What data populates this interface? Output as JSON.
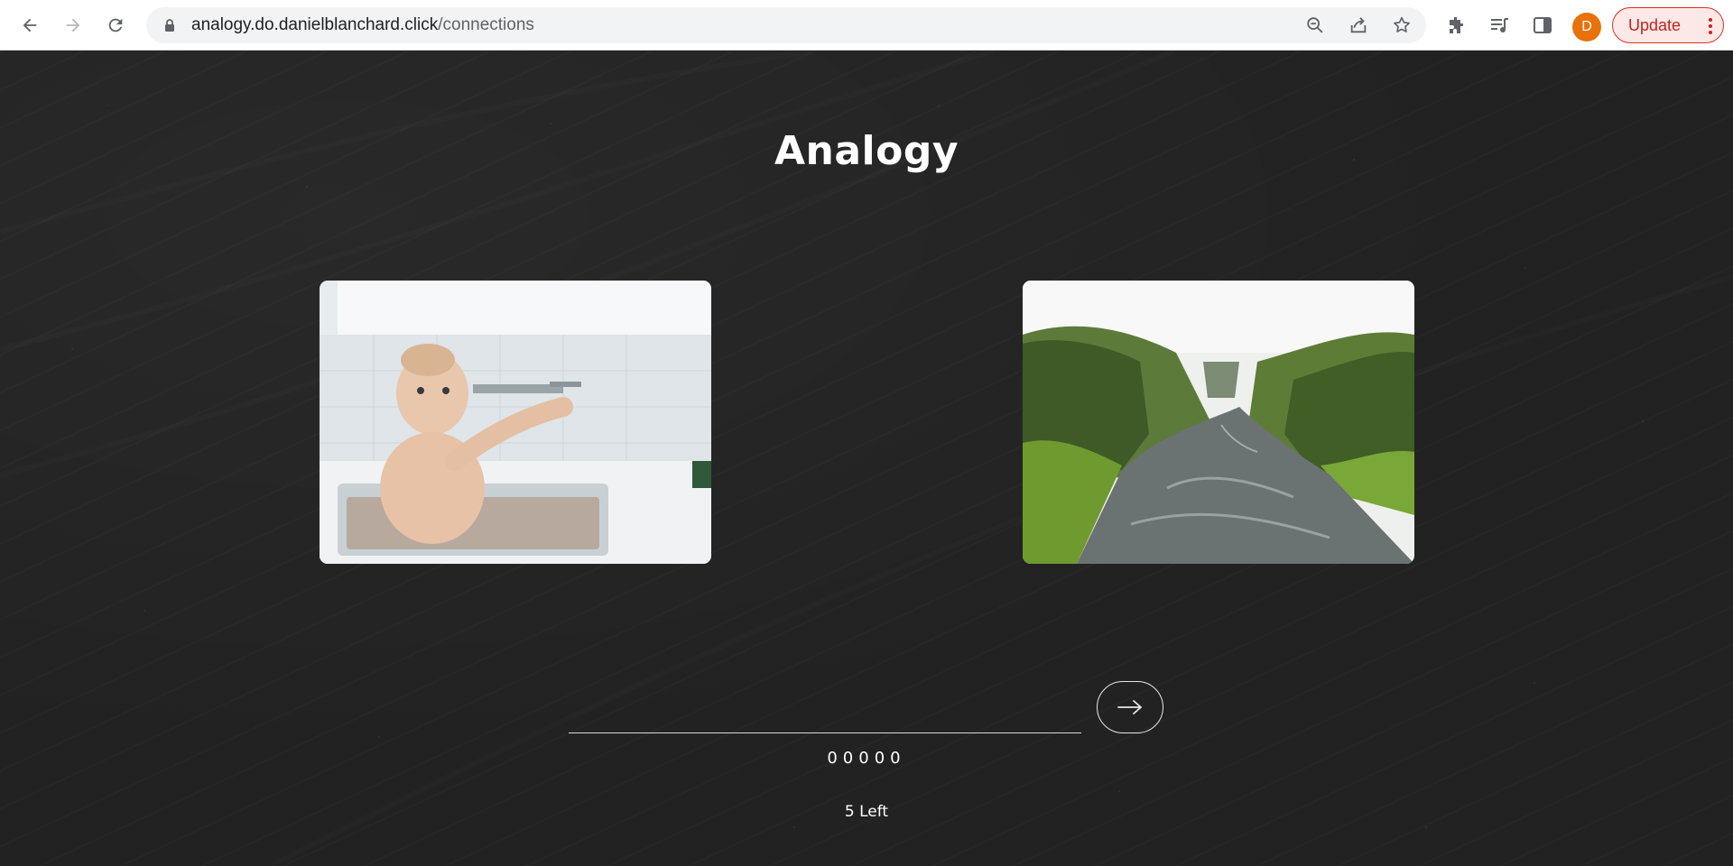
{
  "browser": {
    "url_host": "analogy.do.danielblanchard.click",
    "url_path": "/connections",
    "profile_initial": "D",
    "update_label": "Update",
    "icons": [
      "back-icon",
      "forward-icon",
      "reload-icon",
      "lock-icon",
      "zoom-icon",
      "share-icon",
      "star-icon",
      "extensions-icon",
      "media-icon",
      "side-panel-icon",
      "more-icon"
    ],
    "colors": {
      "avatar": "#e8710a",
      "update_border": "#d93025",
      "update_bg": "#fce8e6"
    }
  },
  "game": {
    "title": "Analogy",
    "left_image": "baby-in-sink-image",
    "right_image": "river-canyon-image",
    "answer_value": "",
    "score": "00000",
    "remaining": "5 Left",
    "colors": {
      "background": "#222222",
      "text": "#ffffff",
      "line": "#d9d9d9"
    }
  }
}
